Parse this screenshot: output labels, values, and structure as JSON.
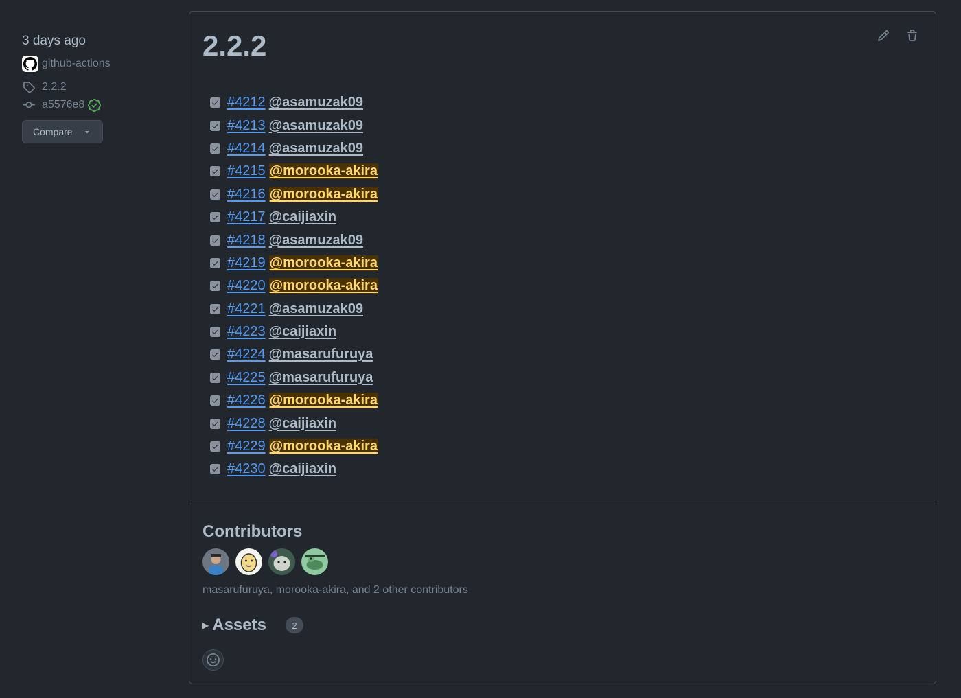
{
  "sidebar": {
    "date": "3 days ago",
    "author": "github-actions",
    "tag": "2.2.2",
    "commit": "a5576e8",
    "compare_label": "Compare"
  },
  "release": {
    "title": "2.2.2",
    "items": [
      {
        "pr": "#4212",
        "user": "@asamuzak09",
        "highlight": false
      },
      {
        "pr": "#4213",
        "user": "@asamuzak09",
        "highlight": false
      },
      {
        "pr": "#4214",
        "user": "@asamuzak09",
        "highlight": false
      },
      {
        "pr": "#4215",
        "user": "@morooka-akira",
        "highlight": true
      },
      {
        "pr": "#4216",
        "user": "@morooka-akira",
        "highlight": true
      },
      {
        "pr": "#4217",
        "user": "@caijiaxin",
        "highlight": false
      },
      {
        "pr": "#4218",
        "user": "@asamuzak09",
        "highlight": false
      },
      {
        "pr": "#4219",
        "user": "@morooka-akira",
        "highlight": true
      },
      {
        "pr": "#4220",
        "user": "@morooka-akira",
        "highlight": true
      },
      {
        "pr": "#4221",
        "user": "@asamuzak09",
        "highlight": false
      },
      {
        "pr": "#4223",
        "user": "@caijiaxin",
        "highlight": false
      },
      {
        "pr": "#4224",
        "user": "@masarufuruya",
        "highlight": false
      },
      {
        "pr": "#4225",
        "user": "@masarufuruya",
        "highlight": false
      },
      {
        "pr": "#4226",
        "user": "@morooka-akira",
        "highlight": true
      },
      {
        "pr": "#4228",
        "user": "@caijiaxin",
        "highlight": false
      },
      {
        "pr": "#4229",
        "user": "@morooka-akira",
        "highlight": true
      },
      {
        "pr": "#4230",
        "user": "@caijiaxin",
        "highlight": false
      }
    ]
  },
  "contributors": {
    "title": "Contributors",
    "avatar_colors": [
      "#6e7681",
      "#f5f5f0",
      "#5a7a6a",
      "#8fc9a0"
    ],
    "summary": "masarufuruya, morooka-akira, and 2 other contributors"
  },
  "assets": {
    "label": "Assets",
    "count": "2"
  },
  "colors": {
    "background": "#22272e",
    "link": "#539bf5",
    "highlight_bg": "#4a3100",
    "highlight_fg": "#ffd76b",
    "verified": "#57ab5a"
  }
}
